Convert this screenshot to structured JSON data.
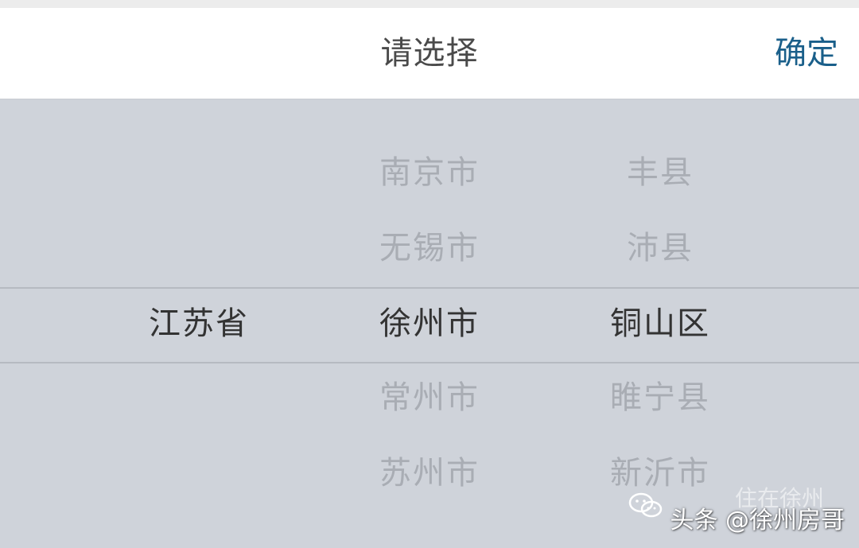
{
  "header": {
    "title": "请选择",
    "confirm_label": "确定"
  },
  "picker": {
    "province": {
      "items": [
        "",
        "",
        "江苏省",
        "",
        ""
      ],
      "selected": "江苏省"
    },
    "city": {
      "items": [
        "南京市",
        "无锡市",
        "徐州市",
        "常州市",
        "苏州市"
      ],
      "selected": "徐州市"
    },
    "district": {
      "items": [
        "丰县",
        "沛县",
        "铜山区",
        "睢宁县",
        "新沂市"
      ],
      "selected": "铜山区"
    }
  },
  "watermark": {
    "faint_text": "住在徐州",
    "text": "头条 @徐州房哥",
    "icon": "wechat-icon"
  },
  "colors": {
    "header_bg": "#ffffff",
    "picker_bg": "#cfd3da",
    "title_text": "#4a4a4a",
    "confirm_text": "#1a5f8a",
    "selected_text": "#333333",
    "unselected_text": "#a9adb4"
  }
}
